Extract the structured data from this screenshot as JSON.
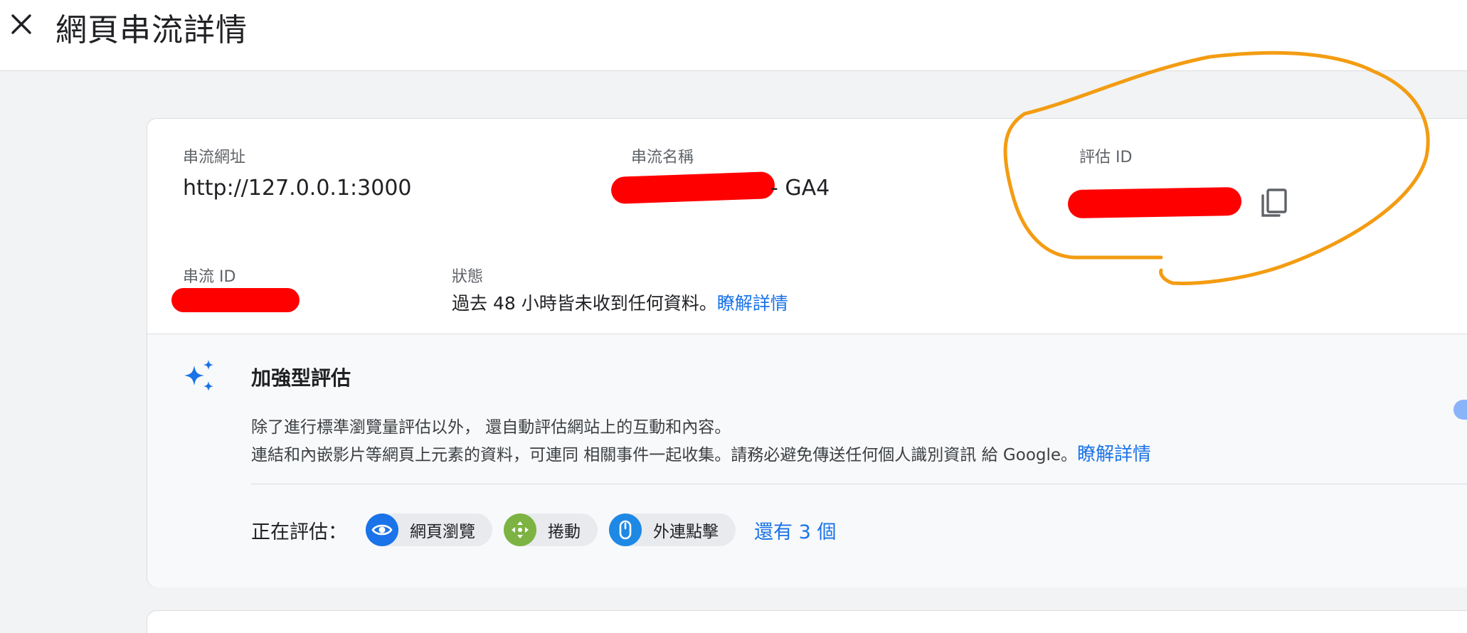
{
  "header": {
    "title": "網頁串流詳情",
    "close_icon": "close-icon"
  },
  "stream": {
    "url_label": "串流網址",
    "url_value": "http://127.0.0.1:3000",
    "name_label": "串流名稱",
    "name_suffix": "- GA4",
    "measurement_id_label": "評估 ID",
    "copy_icon": "copy-icon",
    "stream_id_label": "串流 ID",
    "status_label": "狀態",
    "status_text": "過去 48 小時皆未收到任何資料。",
    "status_link": "瞭解詳情"
  },
  "enhanced": {
    "icon": "sparkle-icon",
    "title": "加強型評估",
    "desc_line1": "除了進行標準瀏覽量評估以外， 還自動評估網站上的互動和內容。",
    "desc_line2": "連結和內嵌影片等網頁上元素的資料，可連同 相關事件一起收集。請務必避免傳送任何個人識別資訊 給 Google。",
    "desc_link": "瞭解詳情",
    "measuring_label": "正在評估：",
    "chips": [
      {
        "label": "網頁瀏覽",
        "icon": "eye-icon",
        "color": "#1a73e8"
      },
      {
        "label": "捲動",
        "icon": "scroll-arrows-icon",
        "color": "#7cb342"
      },
      {
        "label": "外連點擊",
        "icon": "mouse-icon",
        "color": "#1e88e5"
      }
    ],
    "more_link": "還有 3 個"
  },
  "colors": {
    "accent": "#1a73e8",
    "redaction": "#ff0000",
    "annotation": "#f39c12"
  }
}
